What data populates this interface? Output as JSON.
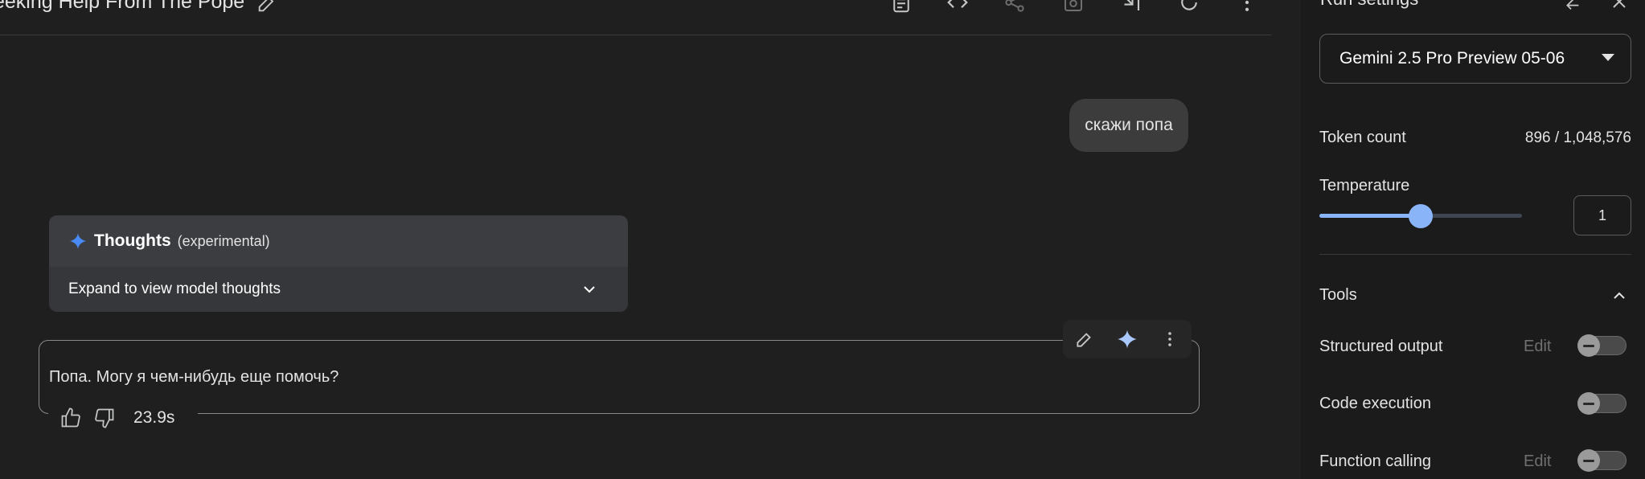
{
  "header": {
    "title": "eeking Help From The Pope",
    "icons": [
      "edit-icon",
      "prompt-icon",
      "code-icon",
      "share-icon",
      "save-icon",
      "compare-icon",
      "refresh-icon",
      "more-icon"
    ]
  },
  "chat": {
    "user_message": "скажи попа",
    "thoughts": {
      "title": "Thoughts",
      "subtitle": "(experimental)",
      "expand_label": "Expand to view model thoughts"
    },
    "model_response": "Попа. Могу я чем-нибудь еще помочь?",
    "response_time": "23.9s"
  },
  "settings": {
    "title": "Run settings",
    "model": "Gemini 2.5 Pro Preview 05-06",
    "token_count_label": "Token count",
    "token_count_value": "896 / 1,048,576",
    "temperature_label": "Temperature",
    "temperature_value": "1",
    "temperature_fraction": 0.5,
    "tools_label": "Tools",
    "tools": [
      {
        "label": "Structured output",
        "edit": "Edit",
        "enabled": false
      },
      {
        "label": "Code execution",
        "enabled": false
      },
      {
        "label": "Function calling",
        "edit": "Edit",
        "enabled": false
      }
    ]
  },
  "colors": {
    "accent": "#8ab4f8",
    "background": "#1f1f1f",
    "panel": "#1b1b1b"
  }
}
